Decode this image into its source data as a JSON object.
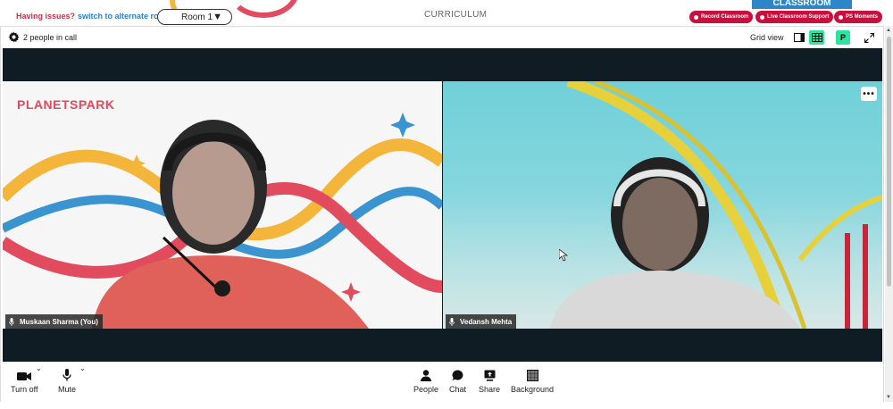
{
  "banner": {
    "issues_text": "Having issues?",
    "alt_link": "switch to alternate room",
    "room_value": "Room 1",
    "curriculum": "CURRICULUM",
    "classroom_tab": "CLASSROOM",
    "buttons": {
      "record": "Record Classroom",
      "support": "Live Classroom Support",
      "moments": "PS Moments"
    }
  },
  "call": {
    "people_count": "2 people in call",
    "grid_view_label": "Grid view",
    "avatar_initial": "P"
  },
  "participants": {
    "left": {
      "name": "Muskaan Sharma (You)",
      "logo_a": "PLANET",
      "logo_b": "SPARK"
    },
    "right": {
      "name": "Vedansh Mehta"
    }
  },
  "controls": {
    "camera": "Turn off",
    "mic": "Mute",
    "people": "People",
    "chat": "Chat",
    "share": "Share",
    "background": "Background"
  },
  "colors": {
    "accent_green": "#2de3a2",
    "brand_red": "#c8103f",
    "brand_blue": "#2e86c9",
    "stage_dark": "#101c24"
  }
}
